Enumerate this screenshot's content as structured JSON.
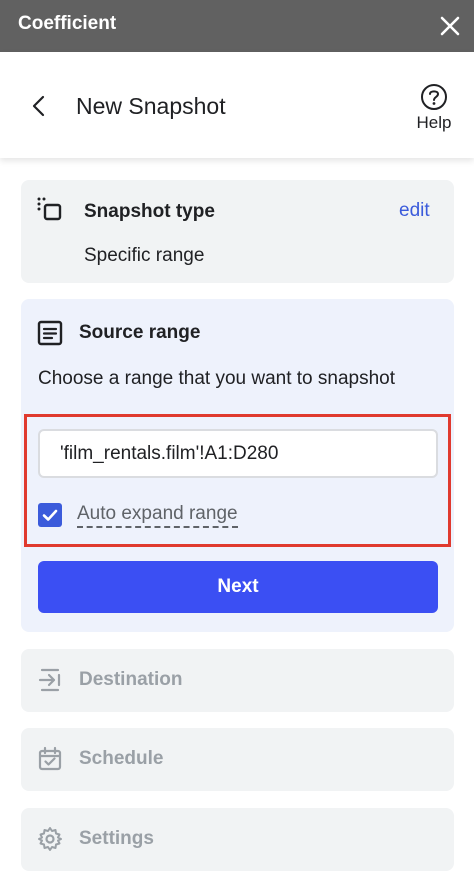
{
  "titlebar": {
    "app_name": "Coefficient",
    "close_icon": "close-icon"
  },
  "header": {
    "title": "New Snapshot",
    "back_icon": "chevron-left-icon",
    "help_label": "Help",
    "help_icon": "help-circle-icon"
  },
  "snapshot_type": {
    "label": "Snapshot type",
    "edit_label": "edit",
    "value": "Specific range",
    "icon": "snapshot-icon"
  },
  "source_range": {
    "label": "Source range",
    "icon": "document-icon",
    "description": "Choose a range that you want to snapshot",
    "range_value": "'film_rentals.film'!A1:D280",
    "auto_expand_label": "Auto expand range",
    "auto_expand_checked": true,
    "next_label": "Next"
  },
  "steps": [
    {
      "label": "Destination",
      "icon": "destination-icon"
    },
    {
      "label": "Schedule",
      "icon": "calendar-icon"
    },
    {
      "label": "Settings",
      "icon": "gear-icon"
    }
  ],
  "colors": {
    "accent": "#3b4ff3",
    "link": "#3b5bdb",
    "highlight": "#e03a2f",
    "titlebar": "#616161"
  }
}
